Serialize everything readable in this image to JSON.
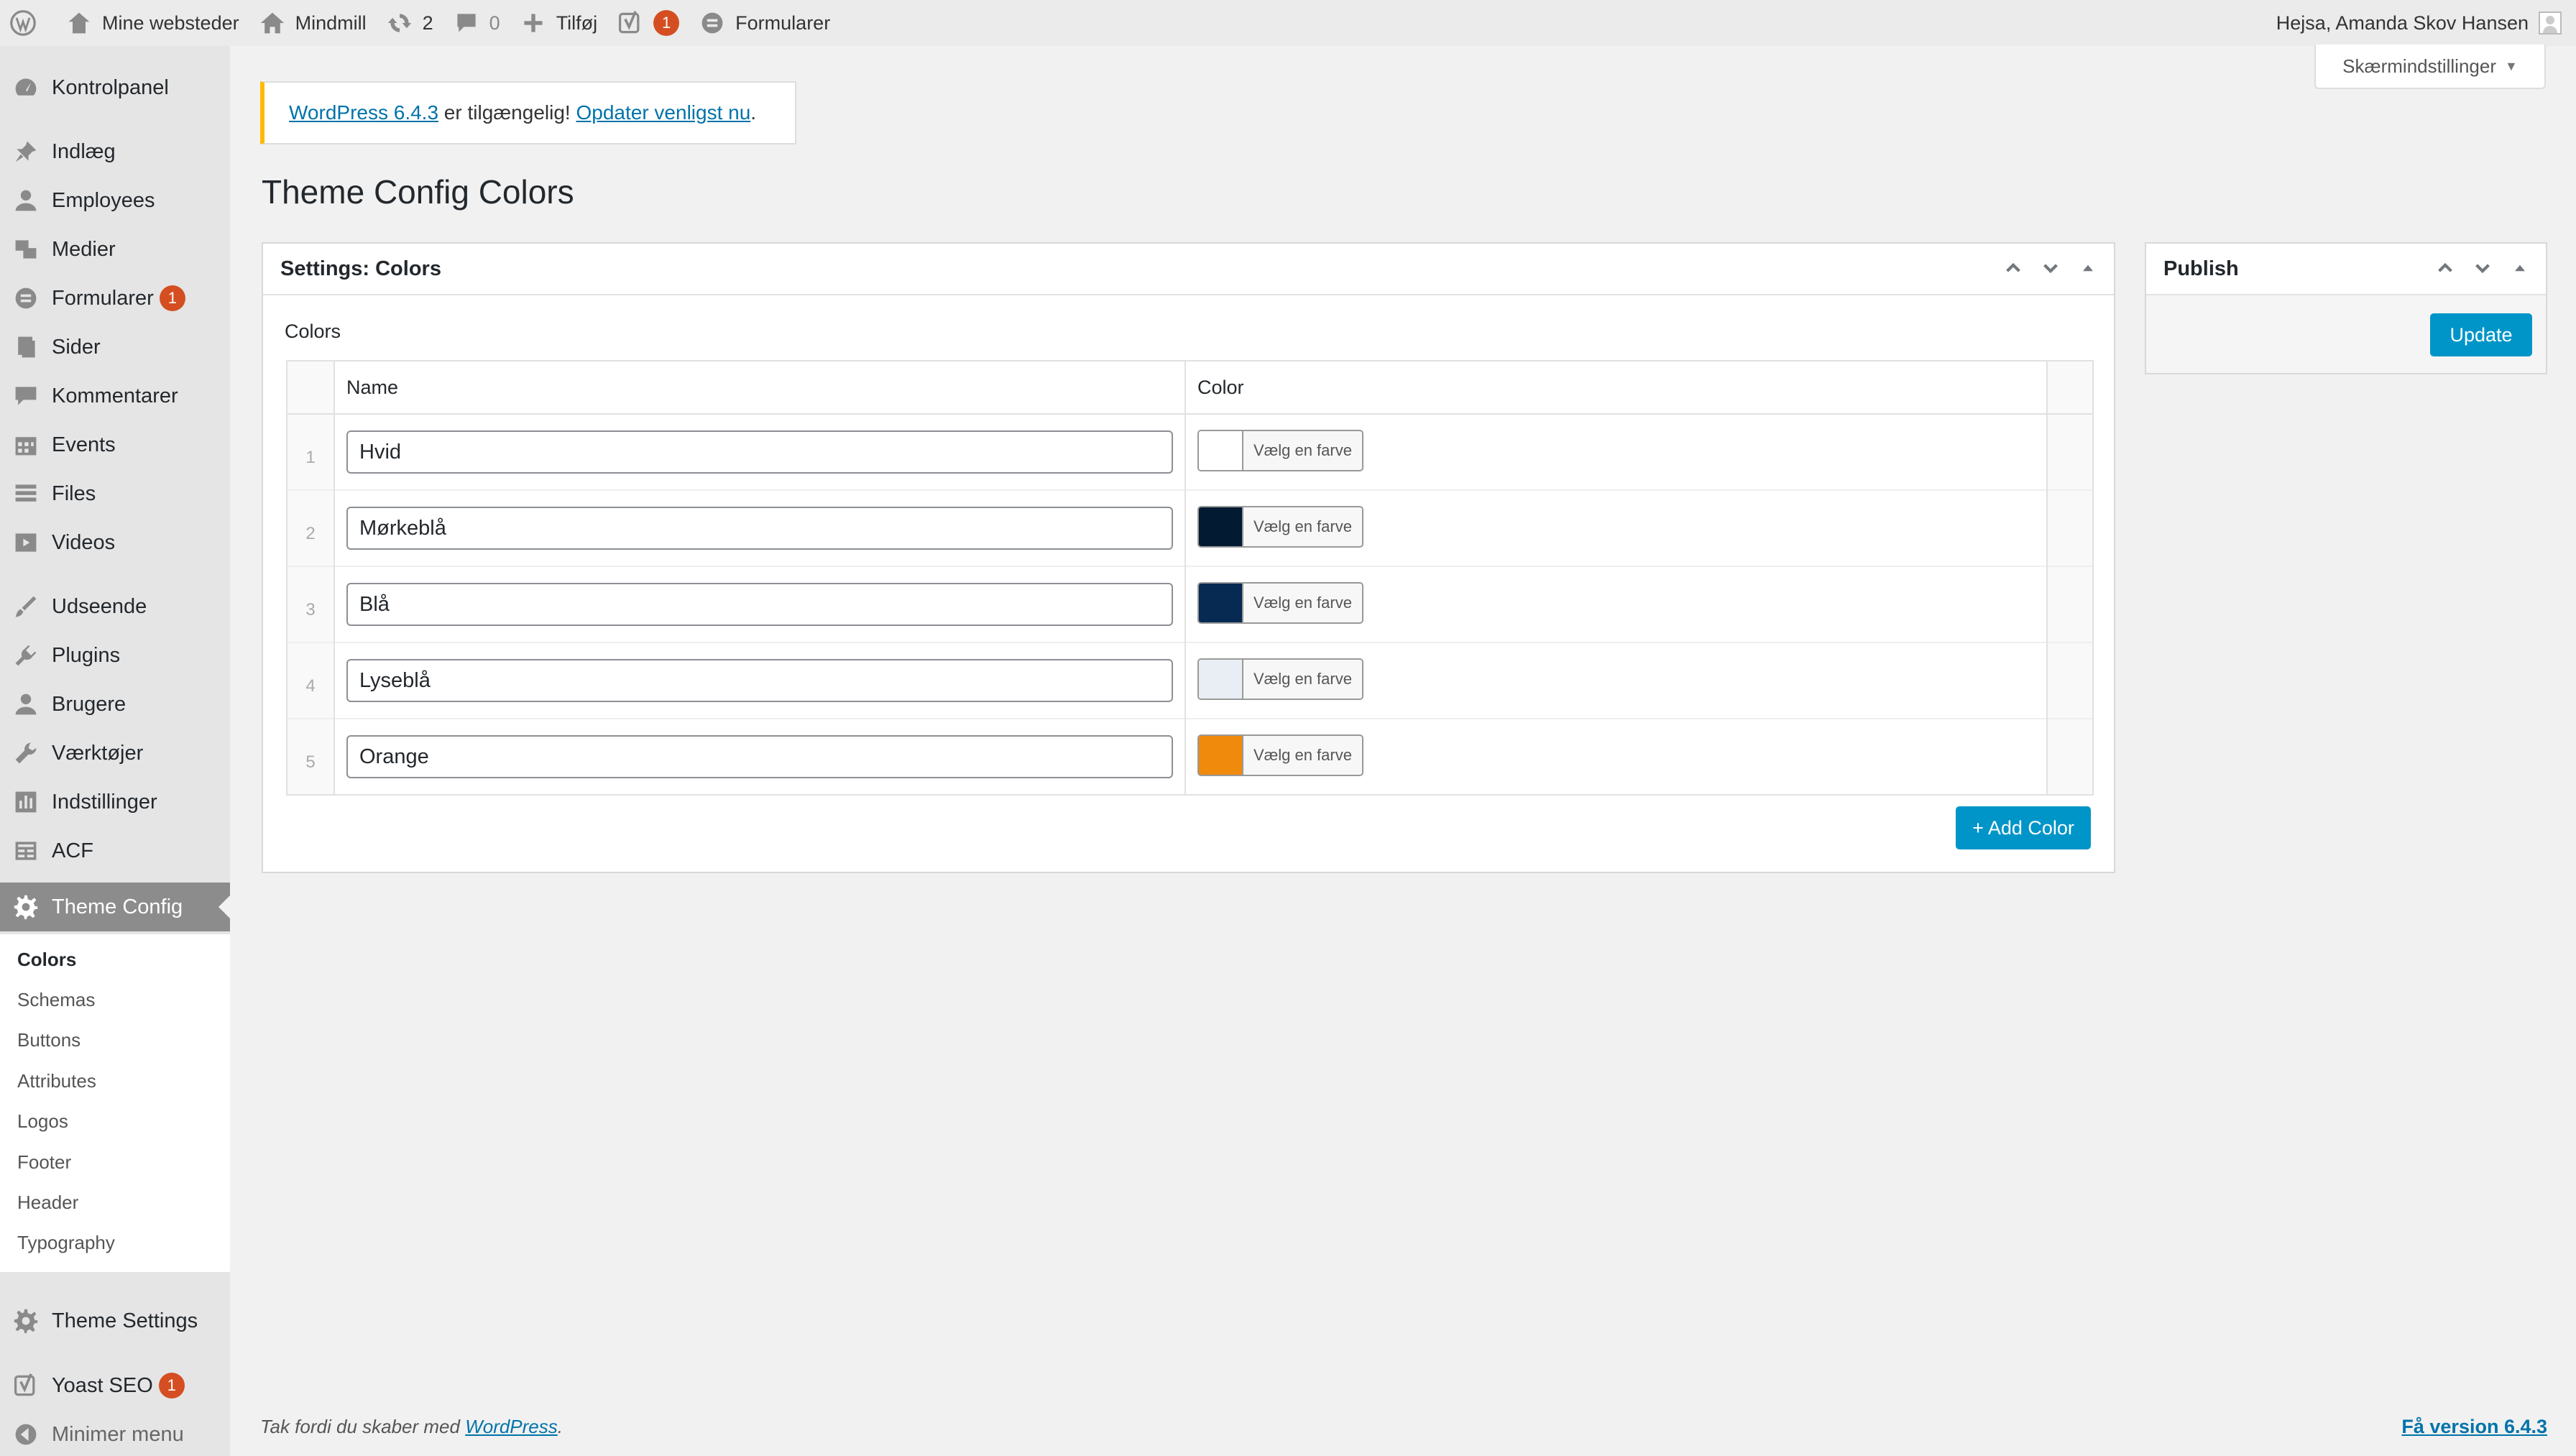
{
  "adminbar": {
    "my_sites": "Mine websteder",
    "site_name": "Mindmill",
    "updates_count": "2",
    "comments_count": "0",
    "new_label": "Tilføj",
    "yoast_count": "1",
    "forms_label": "Formularer",
    "greeting": "Hejsa, Amanda Skov Hansen"
  },
  "screen_options": {
    "label": "Skærmindstillinger",
    "arrow": "▼"
  },
  "sidebar": {
    "items": [
      {
        "label": "Kontrolpanel",
        "icon": "dashboard-icon"
      },
      {
        "label": "Indlæg",
        "icon": "pin-icon"
      },
      {
        "label": "Employees",
        "icon": "user-icon"
      },
      {
        "label": "Medier",
        "icon": "media-icon"
      },
      {
        "label": "Formularer",
        "icon": "forms-icon",
        "badge": "1"
      },
      {
        "label": "Sider",
        "icon": "pages-icon"
      },
      {
        "label": "Kommentarer",
        "icon": "comment-icon"
      },
      {
        "label": "Events",
        "icon": "calendar-icon"
      },
      {
        "label": "Files",
        "icon": "files-icon"
      },
      {
        "label": "Videos",
        "icon": "video-icon"
      },
      {
        "label": "Udseende",
        "icon": "brush-icon"
      },
      {
        "label": "Plugins",
        "icon": "plugin-icon"
      },
      {
        "label": "Brugere",
        "icon": "user-icon"
      },
      {
        "label": "Værktøjer",
        "icon": "wrench-icon"
      },
      {
        "label": "Indstillinger",
        "icon": "settings-icon"
      },
      {
        "label": "ACF",
        "icon": "table-icon"
      },
      {
        "label": "Theme Config",
        "icon": "gear-icon"
      },
      {
        "label": "Theme Settings",
        "icon": "gear-icon"
      },
      {
        "label": "Yoast SEO",
        "icon": "yoast-icon",
        "badge": "1"
      },
      {
        "label": "Minimer menu",
        "icon": "collapse-icon"
      }
    ],
    "submenu": [
      "Colors",
      "Schemas",
      "Buttons",
      "Attributes",
      "Logos",
      "Footer",
      "Header",
      "Typography"
    ]
  },
  "notice": {
    "link1": "WordPress 6.4.3",
    "middle": " er tilgængelig! ",
    "link2": "Opdater venligst nu",
    "end": "."
  },
  "page": {
    "title": "Theme Config Colors"
  },
  "settings_box": {
    "title": "Settings: Colors",
    "field_label": "Colors",
    "columns": {
      "name": "Name",
      "color": "Color"
    },
    "rows": [
      {
        "index": "1",
        "name": "Hvid",
        "color": "#ffffff"
      },
      {
        "index": "2",
        "name": "Mørkeblå",
        "color": "#031a33"
      },
      {
        "index": "3",
        "name": "Blå",
        "color": "#062a52"
      },
      {
        "index": "4",
        "name": "Lyseblå",
        "color": "#e8eef4"
      },
      {
        "index": "5",
        "name": "Orange",
        "color": "#f08a0c"
      }
    ],
    "picker_label": "Vælg en farve",
    "add_button": "+ Add Color"
  },
  "publish_box": {
    "title": "Publish",
    "update_button": "Update"
  },
  "footer": {
    "thanks_prefix": "Tak fordi du skaber med ",
    "wordpress_link": "WordPress",
    "thanks_suffix": ".",
    "version_link": "Få version 6.4.3"
  },
  "colors": {
    "link": "#0073aa",
    "primary_button": "#0095c8",
    "notice_border": "#ffb900",
    "badge": "#d54e21"
  }
}
